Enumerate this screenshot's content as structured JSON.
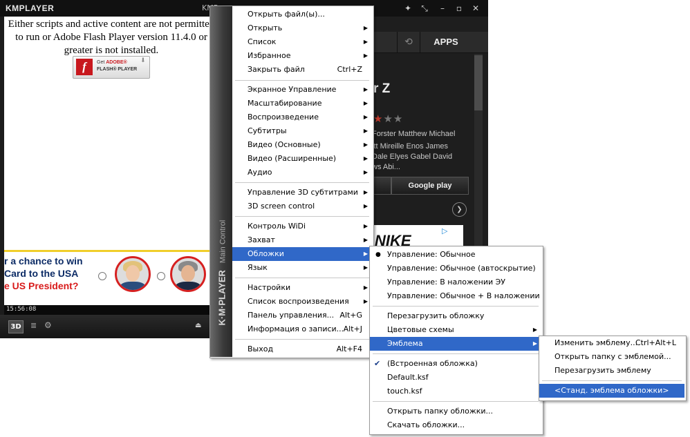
{
  "player": {
    "logo": "KMPLAYER",
    "window_title": "KMP...",
    "window_buttons": [
      "pin",
      "minimize-mode",
      "minimize",
      "maximize",
      "close"
    ],
    "flash_message": "Either scripts and active content are not permitted to run or Adobe Flash Player version 11.4.0 or greater is not installed.",
    "flash_button": {
      "line1_prefix": "Get ",
      "line1_brand": "ADOBE®",
      "line2": "FLASH® PLAYER",
      "logo_glyph": "f"
    },
    "ad": {
      "line1": "r a chance to win",
      "line2": "Card to the USA",
      "line3": "e US President?"
    },
    "time": "15:56:08",
    "btn_3d": "3D"
  },
  "side_panel": {
    "apps_label": "APPS",
    "movie_title": "r Z",
    "rating": 3,
    "cast_lines": [
      "Forster Matthew Michael",
      "itt Mireille Enos James",
      "Dale Elyes Gabel David",
      "ws Abi..."
    ],
    "store_button": "Google play",
    "ad_text": "NIKE",
    "adchoice": "▷"
  },
  "main_menu": {
    "side_label": "K·M·PLAYER",
    "side_sublabel": "Main Control",
    "items": [
      {
        "label": "Открыть файл(ы)...",
        "shortcut": "",
        "submenu": false
      },
      {
        "label": "Открыть",
        "shortcut": "",
        "submenu": true
      },
      {
        "label": "Список",
        "shortcut": "",
        "submenu": true
      },
      {
        "label": "Избранное",
        "shortcut": "",
        "submenu": true
      },
      {
        "label": "Закрыть файл",
        "shortcut": "Ctrl+Z",
        "submenu": false
      },
      {
        "label": "Экранное Управление",
        "shortcut": "",
        "submenu": true
      },
      {
        "label": "Масштабирование",
        "shortcut": "",
        "submenu": true
      },
      {
        "label": "Воспроизведение",
        "shortcut": "",
        "submenu": true
      },
      {
        "label": "Субтитры",
        "shortcut": "",
        "submenu": true
      },
      {
        "label": "Видео (Основные)",
        "shortcut": "",
        "submenu": true
      },
      {
        "label": "Видео (Расширенные)",
        "shortcut": "",
        "submenu": true
      },
      {
        "label": "Аудио",
        "shortcut": "",
        "submenu": true
      },
      {
        "label": "Управление 3D субтитрами",
        "shortcut": "",
        "submenu": true
      },
      {
        "label": "3D screen control",
        "shortcut": "",
        "submenu": true
      },
      {
        "label": "Контроль WiDi",
        "shortcut": "",
        "submenu": true
      },
      {
        "label": "Захват",
        "shortcut": "",
        "submenu": true
      },
      {
        "label": "Обложки",
        "shortcut": "",
        "submenu": true
      },
      {
        "label": "Язык",
        "shortcut": "",
        "submenu": true
      },
      {
        "label": "Настройки",
        "shortcut": "",
        "submenu": true
      },
      {
        "label": "Список воспроизведения",
        "shortcut": "",
        "submenu": true
      },
      {
        "label": "Панель управления...",
        "shortcut": "Alt+G",
        "submenu": false
      },
      {
        "label": "Информация о записи...",
        "shortcut": "Alt+J",
        "submenu": false
      },
      {
        "label": "Выход",
        "shortcut": "Alt+F4",
        "submenu": false
      }
    ]
  },
  "skins_menu": {
    "items": [
      {
        "label": "Управление: Обычное",
        "mark": "●"
      },
      {
        "label": "Управление: Обычное (автоскрытие)",
        "mark": ""
      },
      {
        "label": "Управление: В наложении ЭУ",
        "mark": ""
      },
      {
        "label": "Управление: Обычное + В наложении",
        "mark": ""
      },
      {
        "label": "Перезагрузить обложку",
        "mark": ""
      },
      {
        "label": "Цветовые схемы",
        "mark": ""
      },
      {
        "label": "Эмблема",
        "mark": ""
      },
      {
        "label": "(Встроенная обложка)",
        "mark": "✔"
      },
      {
        "label": "Default.ksf",
        "mark": ""
      },
      {
        "label": "touch.ksf",
        "mark": ""
      },
      {
        "label": "Открыть папку обложки...",
        "mark": ""
      },
      {
        "label": "Скачать обложки...",
        "mark": ""
      }
    ]
  },
  "emblem_menu": {
    "items": [
      {
        "label": "Изменить эмблему...",
        "shortcut": "Ctrl+Alt+L"
      },
      {
        "label": "Открыть папку с эмблемой...",
        "shortcut": ""
      },
      {
        "label": "Перезагрузить эмблему",
        "shortcut": ""
      },
      {
        "label": "<Станд. эмблема обложки>",
        "shortcut": ""
      }
    ]
  }
}
